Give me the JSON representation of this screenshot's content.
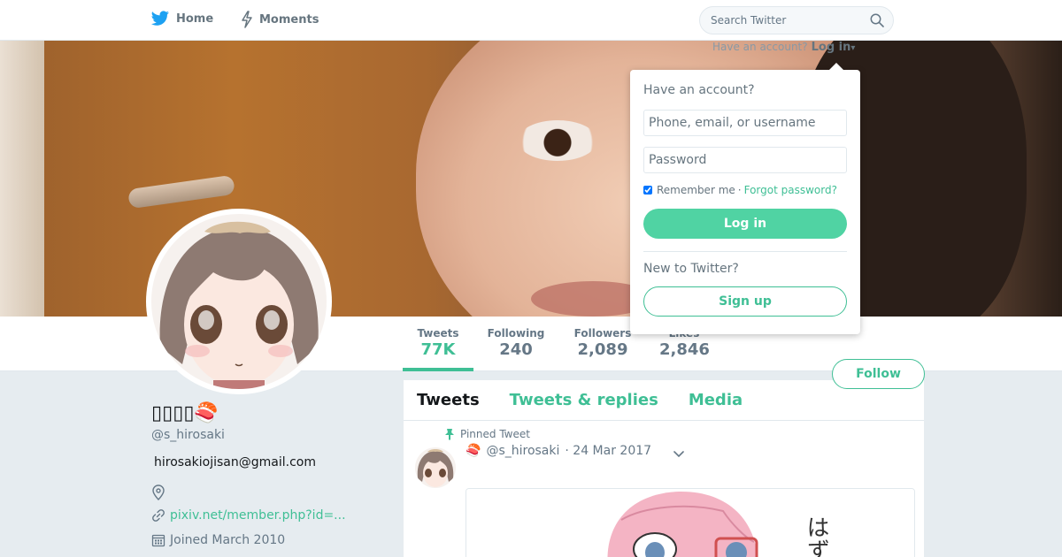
{
  "nav": {
    "home_label": "Home",
    "home_icon": "twitter-bird-icon",
    "moments_label": "Moments",
    "moments_icon": "lightning-icon",
    "search_placeholder": "Search Twitter",
    "search_icon": "search-icon"
  },
  "login_hint": {
    "text": "Have an account?",
    "link": "Log in",
    "caret": "▾"
  },
  "stats": [
    {
      "label": "Tweets",
      "value": "77K",
      "active": true
    },
    {
      "label": "Following",
      "value": "240",
      "active": false
    },
    {
      "label": "Followers",
      "value": "2,089",
      "active": false
    },
    {
      "label": "Likes",
      "value": "2,846",
      "active": false
    }
  ],
  "follow_label": "Follow",
  "profile": {
    "name": "▯▯▯▯🍣",
    "handle": "@s_hirosaki",
    "bio": "hirosakiojisan@gmail.com",
    "location": "",
    "url": "pixiv.net/member.php?id=...",
    "joined": "Joined March 2010"
  },
  "tabs": [
    {
      "label": "Tweets",
      "active": true
    },
    {
      "label": "Tweets & replies",
      "active": false
    },
    {
      "label": "Media",
      "active": false
    }
  ],
  "tweet": {
    "pinned_label": "Pinned Tweet",
    "name": "🍣",
    "handle": "@s_hirosaki",
    "date": "· 24 Mar 2017",
    "media_text": "はずい"
  },
  "login_dropdown": {
    "title": "Have an account?",
    "username_placeholder": "Phone, email, or username",
    "password_placeholder": "Password",
    "remember_label": "Remember me",
    "separator": "·",
    "forgot_label": "Forgot password?",
    "login_button": "Log in",
    "new_label": "New to Twitter?",
    "signup_button": "Sign up"
  },
  "colors": {
    "accent": "#3fbf95",
    "login_button_bg": "#50d3a3",
    "background": "#e6ecf0",
    "muted_text": "#657786"
  }
}
